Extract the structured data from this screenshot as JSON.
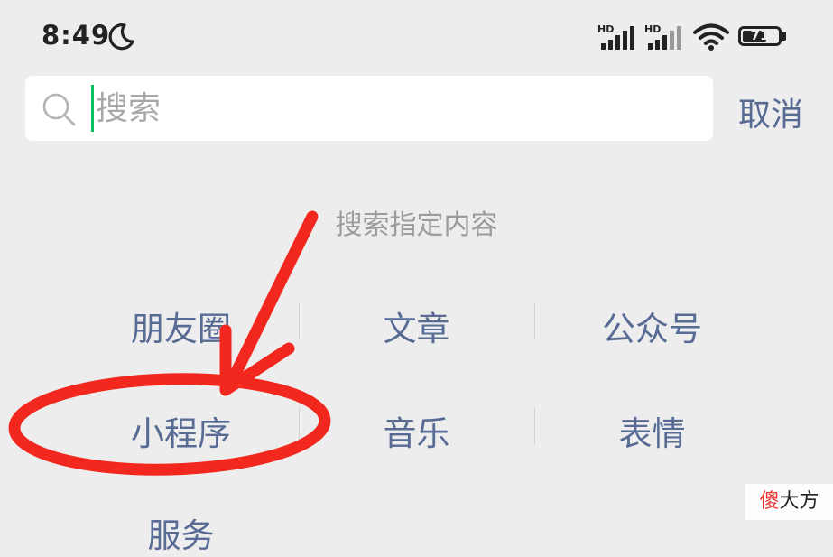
{
  "status_bar": {
    "time": "8:49",
    "signal_1_label": "HD",
    "signal_2_label": "HD",
    "battery_level": 71,
    "battery_text": "71",
    "icons": [
      "moon-icon",
      "signal-icon",
      "signal-icon",
      "wifi-icon",
      "battery-icon"
    ]
  },
  "search": {
    "placeholder": "搜索",
    "value": "",
    "cancel_label": "取消"
  },
  "hint": "搜索指定内容",
  "categories": [
    {
      "label": "朋友圈"
    },
    {
      "label": "文章"
    },
    {
      "label": "公众号"
    },
    {
      "label": "小程序"
    },
    {
      "label": "音乐"
    },
    {
      "label": "表情"
    },
    {
      "label": "服务"
    }
  ],
  "watermark": {
    "accent": "傻",
    "rest": "大方"
  },
  "colors": {
    "background": "#ededed",
    "link_blue": "#576b95",
    "cursor_green": "#07c160",
    "annotation_red": "#f2281e",
    "hint_gray": "#9b9b9b"
  }
}
